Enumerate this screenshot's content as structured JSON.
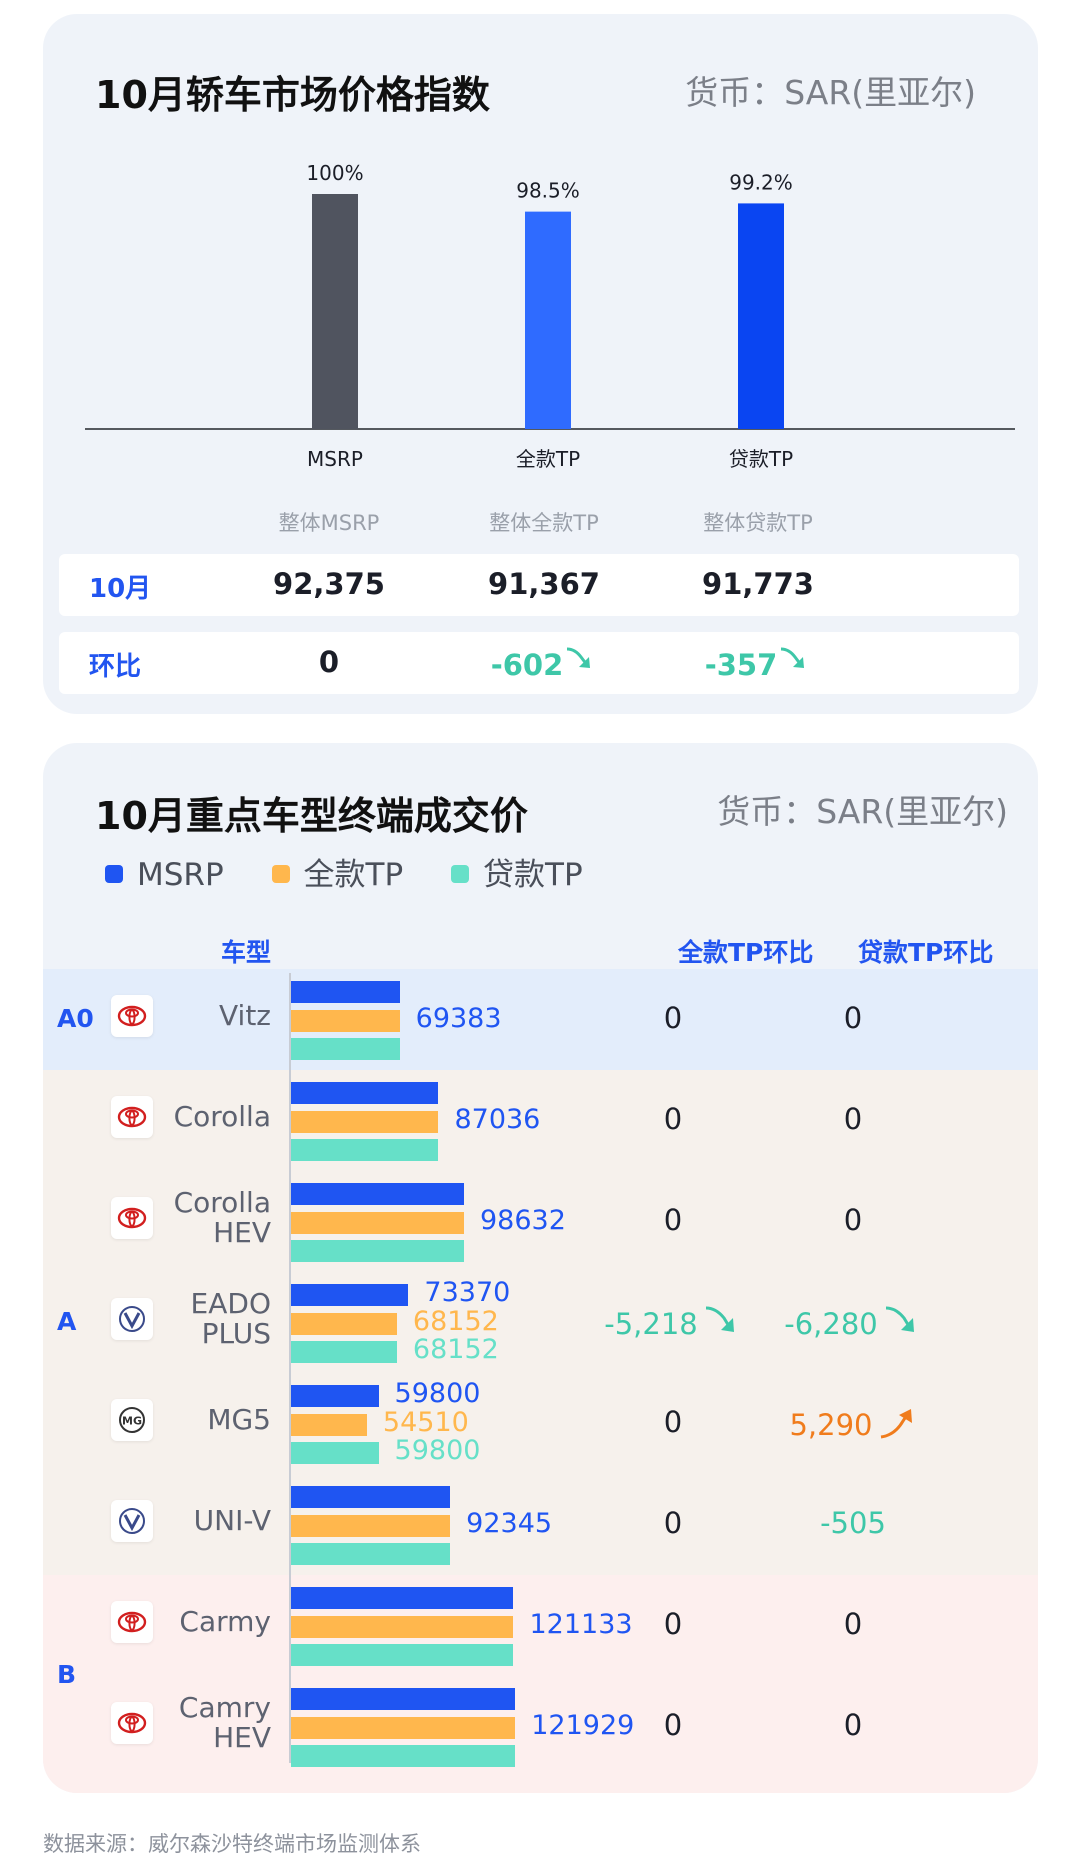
{
  "chart_data": [
    {
      "type": "bar",
      "title": "10月轿车市场价格指数",
      "currency": "货币：SAR(里亚尔)",
      "categories": [
        "MSRP",
        "全款TP",
        "贷款TP"
      ],
      "values": [
        100,
        98.5,
        99.2
      ],
      "value_labels": [
        "100%",
        "98.5%",
        "99.2%"
      ],
      "colors": [
        "#50545f",
        "#2f6bff",
        "#0a45f2"
      ],
      "summary": {
        "headers": [
          "整体MSRP",
          "整体全款TP",
          "整体贷款TP"
        ],
        "rows": [
          {
            "label": "10月",
            "values": [
              "92,375",
              "91,367",
              "91,773"
            ],
            "trend": [
              "",
              "",
              ""
            ]
          },
          {
            "label": "环比",
            "values": [
              "0",
              "-602",
              "-357"
            ],
            "trend": [
              "",
              "down",
              "down"
            ]
          }
        ]
      }
    },
    {
      "type": "bar",
      "title": "10月重点车型终端成交价",
      "currency": "货币：SAR(里亚尔)",
      "legend": [
        "MSRP",
        "全款TP",
        "贷款TP"
      ],
      "series_colors": [
        "#1f55f2",
        "#ffb74d",
        "#66e0c8"
      ],
      "headers": {
        "model": "车型",
        "full_change": "全款TP环比",
        "loan_change": "贷款TP环比"
      },
      "segments": [
        {
          "label": "A0",
          "color": "#e3edfb"
        },
        {
          "label": "A",
          "color": "#f6f1ec"
        },
        {
          "label": "B",
          "color": "#fdefee"
        }
      ],
      "models": [
        {
          "name": [
            "Vitz"
          ],
          "brand": "toyota",
          "msrp": 69383,
          "full_tp": 69383,
          "loan_tp": 69383,
          "labels": [
            "69383"
          ],
          "full_change": "0",
          "full_trend": "",
          "loan_change": "0",
          "loan_trend": ""
        },
        {
          "name": [
            "Corolla"
          ],
          "brand": "toyota",
          "msrp": 87036,
          "full_tp": 87036,
          "loan_tp": 87036,
          "labels": [
            "87036"
          ],
          "full_change": "0",
          "full_trend": "",
          "loan_change": "0",
          "loan_trend": ""
        },
        {
          "name": [
            "Corolla",
            "HEV"
          ],
          "brand": "toyota",
          "msrp": 98632,
          "full_tp": 98632,
          "loan_tp": 98632,
          "labels": [
            "98632"
          ],
          "full_change": "0",
          "full_trend": "",
          "loan_change": "0",
          "loan_trend": ""
        },
        {
          "name": [
            "EADO",
            "PLUS"
          ],
          "brand": "changan",
          "msrp": 73370,
          "full_tp": 68152,
          "loan_tp": 68152,
          "labels": [
            "73370",
            "68152",
            "68152"
          ],
          "full_change": "-5,218",
          "full_trend": "down",
          "loan_change": "-6,280",
          "loan_trend": "down"
        },
        {
          "name": [
            "MG5"
          ],
          "brand": "mg",
          "msrp": 59800,
          "full_tp": 54510,
          "loan_tp": 59800,
          "labels": [
            "59800",
            "54510",
            "59800"
          ],
          "full_change": "0",
          "full_trend": "",
          "loan_change": "5,290",
          "loan_trend": "up"
        },
        {
          "name": [
            "UNI-V"
          ],
          "brand": "changan",
          "msrp": 92345,
          "full_tp": 92345,
          "loan_tp": 92345,
          "labels": [
            "92345"
          ],
          "full_change": "0",
          "full_trend": "",
          "loan_change": "-505",
          "loan_trend": "down"
        },
        {
          "name": [
            "Carmy"
          ],
          "brand": "toyota",
          "msrp": 121133,
          "full_tp": 121133,
          "loan_tp": 121133,
          "labels": [
            "121133"
          ],
          "full_change": "0",
          "full_trend": "",
          "loan_change": "0",
          "loan_trend": ""
        },
        {
          "name": [
            "Camry",
            "HEV"
          ],
          "brand": "toyota",
          "msrp": 121929,
          "full_tp": 121929,
          "loan_tp": 121929,
          "labels": [
            "121929"
          ],
          "full_change": "0",
          "full_trend": "",
          "loan_change": "0",
          "loan_trend": ""
        }
      ]
    }
  ],
  "footer": {
    "source": "数据来源：威尔森沙特终端市场监测体系"
  }
}
